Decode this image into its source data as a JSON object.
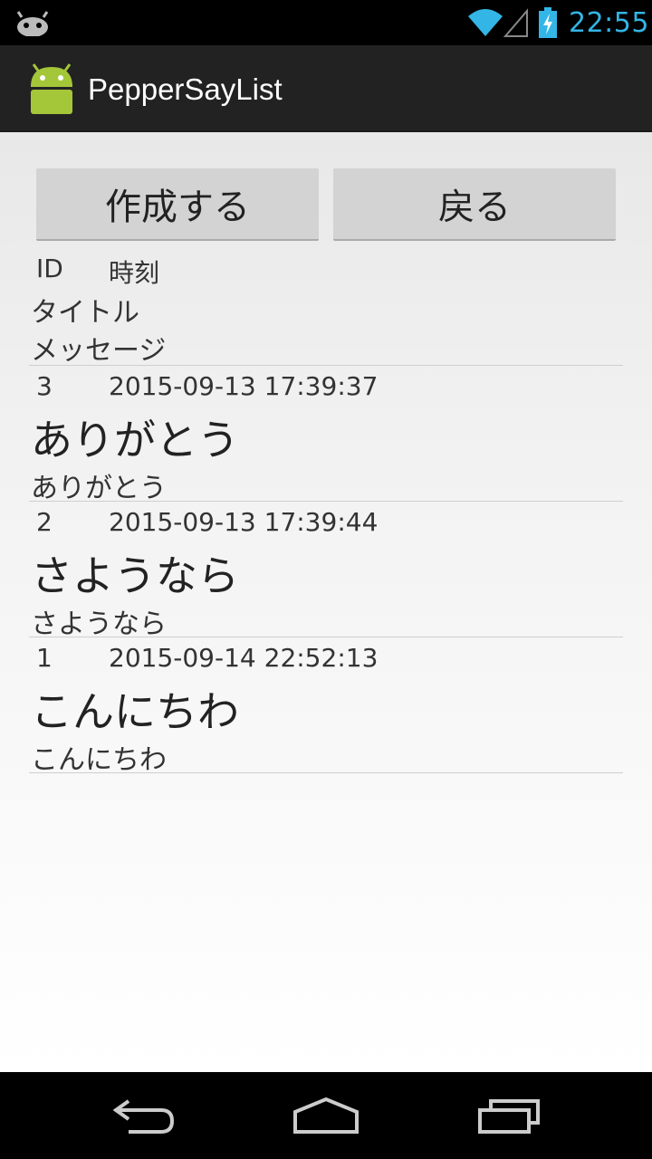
{
  "status": {
    "time": "22:55"
  },
  "app": {
    "title": "PepperSayList"
  },
  "buttons": {
    "create": "作成する",
    "back": "戻る"
  },
  "header": {
    "id": "ID",
    "time": "時刻",
    "title": "タイトル",
    "message": "メッセージ"
  },
  "items": [
    {
      "id": "3",
      "time": "2015-09-13 17:39:37",
      "title": "ありがとう",
      "message": "ありがとう"
    },
    {
      "id": "2",
      "time": "2015-09-13 17:39:44",
      "title": "さようなら",
      "message": "さようなら"
    },
    {
      "id": "1",
      "time": "2015-09-14 22:52:13",
      "title": "こんにちわ",
      "message": "こんにちわ"
    }
  ],
  "colors": {
    "accent": "#33b5e5",
    "android_green": "#a4c639",
    "actionbar": "#222222"
  }
}
